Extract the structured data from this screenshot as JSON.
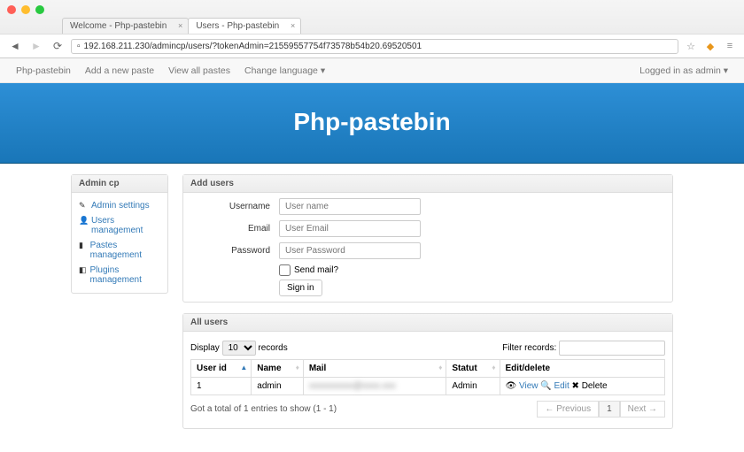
{
  "browser": {
    "tabs": [
      {
        "title": "Welcome - Php-pastebin"
      },
      {
        "title": "Users - Php-pastebin"
      }
    ],
    "url": "192.168.211.230/admincp/users/?tokenAdmin=21559557754f73578b54b20.69520501"
  },
  "topnav": {
    "brand": "Php-pastebin",
    "links": {
      "add": "Add a new paste",
      "view": "View all pastes",
      "lang": "Change language"
    },
    "right": "Logged in as admin"
  },
  "hero_title": "Php-pastebin",
  "sidebar": {
    "title": "Admin cp",
    "items": [
      {
        "label": "Admin settings"
      },
      {
        "label": "Users management"
      },
      {
        "label": "Pastes management"
      },
      {
        "label": "Plugins management"
      }
    ]
  },
  "add_users": {
    "title": "Add users",
    "username_label": "Username",
    "username_ph": "User name",
    "email_label": "Email",
    "email_ph": "User Email",
    "password_label": "Password",
    "password_ph": "User Password",
    "sendmail_label": "Send mail?",
    "submit": "Sign in"
  },
  "all_users": {
    "title": "All users",
    "display_label": "Display",
    "page_size": "10",
    "records_label": "records",
    "filter_label": "Filter records:",
    "columns": {
      "id": "User id",
      "name": "Name",
      "mail": "Mail",
      "statut": "Statut",
      "edit": "Edit/delete"
    },
    "row": {
      "id": "1",
      "name": "admin",
      "mail": "xxxxxxxxxx@xxxx.xxx",
      "statut": "Admin",
      "view": "View",
      "edit": "Edit",
      "delete": "Delete"
    },
    "footer_info": "Got a total of 1 entries to show (1 - 1)",
    "pager": {
      "prev": "← Previous",
      "page": "1",
      "next": "Next →"
    }
  }
}
